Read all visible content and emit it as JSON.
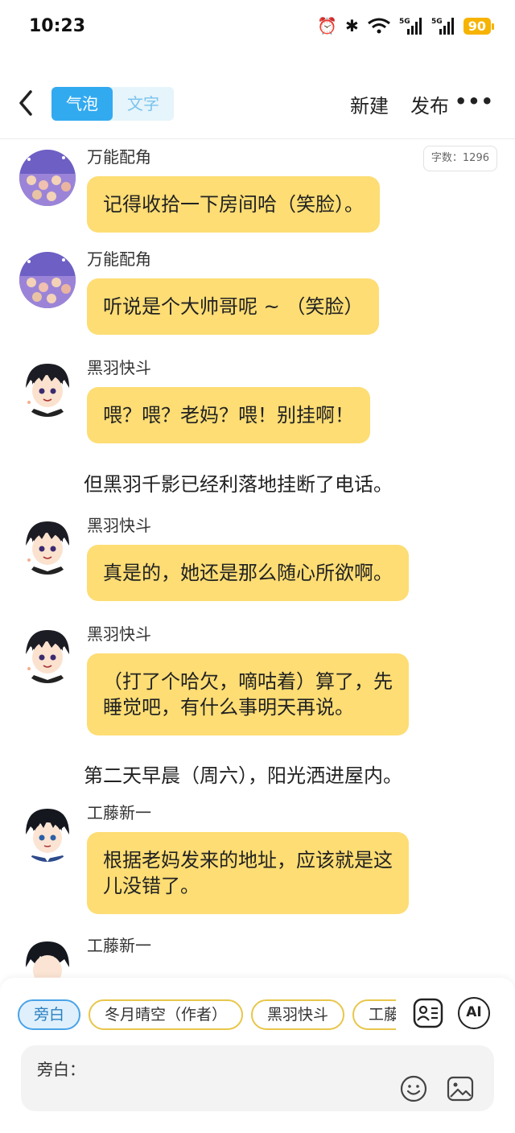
{
  "status_bar": {
    "time": "10:23",
    "battery": "90"
  },
  "header": {
    "tabs": [
      {
        "label": "气泡"
      },
      {
        "label": "文字"
      }
    ],
    "new_label": "新建",
    "publish_label": "发布"
  },
  "word_count": "字数：1296",
  "chat": [
    {
      "type": "bubble",
      "speaker": "万能配角",
      "text": "记得收拾一下房间哈（笑脸）。"
    },
    {
      "type": "bubble",
      "speaker": "万能配角",
      "text": "听说是个大帅哥呢 ~ （笑脸）"
    },
    {
      "type": "bubble",
      "speaker": "黑羽快斗",
      "text": "喂？喂？老妈？喂！别挂啊！"
    },
    {
      "type": "narration",
      "text": "但黑羽千影已经利落地挂断了电话。"
    },
    {
      "type": "bubble",
      "speaker": "黑羽快斗",
      "text": "真是的，她还是那么随心所欲啊。"
    },
    {
      "type": "bubble",
      "speaker": "黑羽快斗",
      "line1": "（打了个哈欠，嘀咕着）算了，先",
      "line2": "睡觉吧，有什么事明天再说。"
    },
    {
      "type": "narration",
      "text": "第二天早晨（周六），阳光洒进屋内。"
    },
    {
      "type": "bubble",
      "speaker": "工藤新一",
      "line1": "根据老妈发来的地址，应该就是这",
      "line2": "儿没错了。"
    },
    {
      "type": "bubble",
      "speaker": "工藤新一"
    }
  ],
  "bottom": {
    "chips": [
      "旁白",
      "冬月晴空（作者）",
      "黑羽快斗",
      "工藤"
    ],
    "ai_label": "AI",
    "input_label": "旁白："
  },
  "colors": {
    "bubble": "#fddd74",
    "accent": "#32aaf0",
    "chip_border": "#e8c64a"
  }
}
